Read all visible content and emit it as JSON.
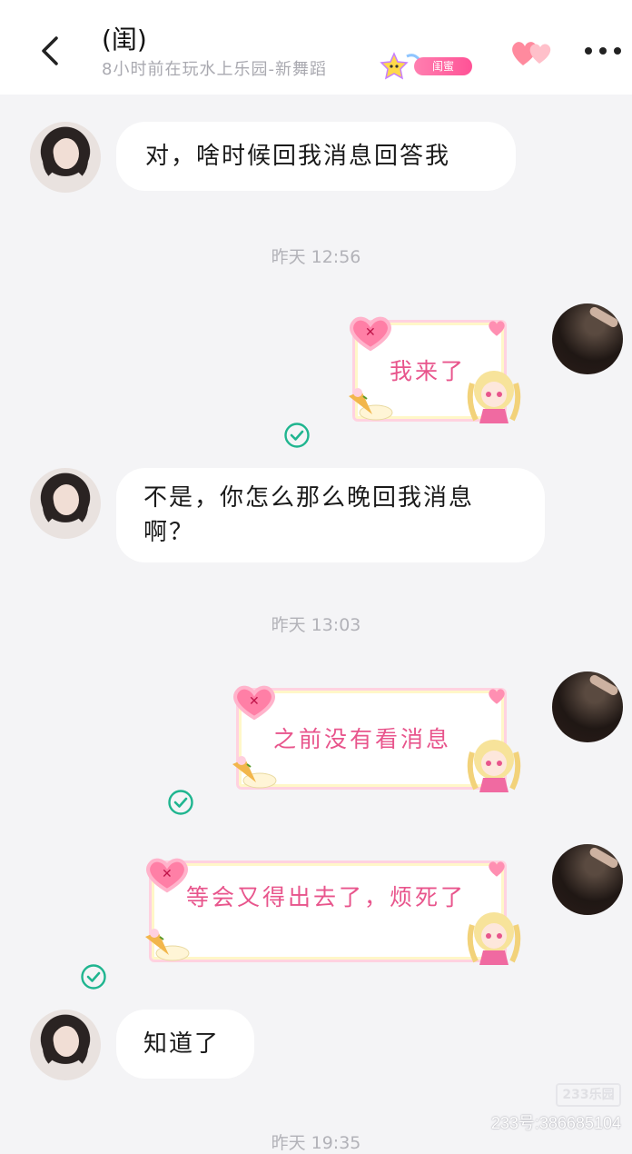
{
  "header": {
    "title": "(闺)",
    "status": "8小时前在玩水上乐园-新舞蹈",
    "relation_badge": "闺蜜"
  },
  "messages": [
    {
      "side": "in",
      "text": "对，啥时候回我消息回答我"
    },
    {
      "side": "timestamp",
      "text": "昨天 12:56"
    },
    {
      "side": "out",
      "text": "我来了"
    },
    {
      "side": "in",
      "text": "不是，你怎么那么晚回我消息啊？"
    },
    {
      "side": "timestamp",
      "text": "昨天 13:03"
    },
    {
      "side": "out",
      "text": "之前没有看消息"
    },
    {
      "side": "out",
      "text": "等会又得出去了，烦死了"
    },
    {
      "side": "in",
      "text": "知道了"
    },
    {
      "side": "timestamp",
      "text": "昨天 19:35"
    }
  ],
  "watermark": {
    "logo": "233乐园",
    "id": "233号:386685104"
  },
  "colors": {
    "accent_pink": "#e8558c",
    "read_check": "#1fb58f",
    "background": "#f4f4f6"
  }
}
